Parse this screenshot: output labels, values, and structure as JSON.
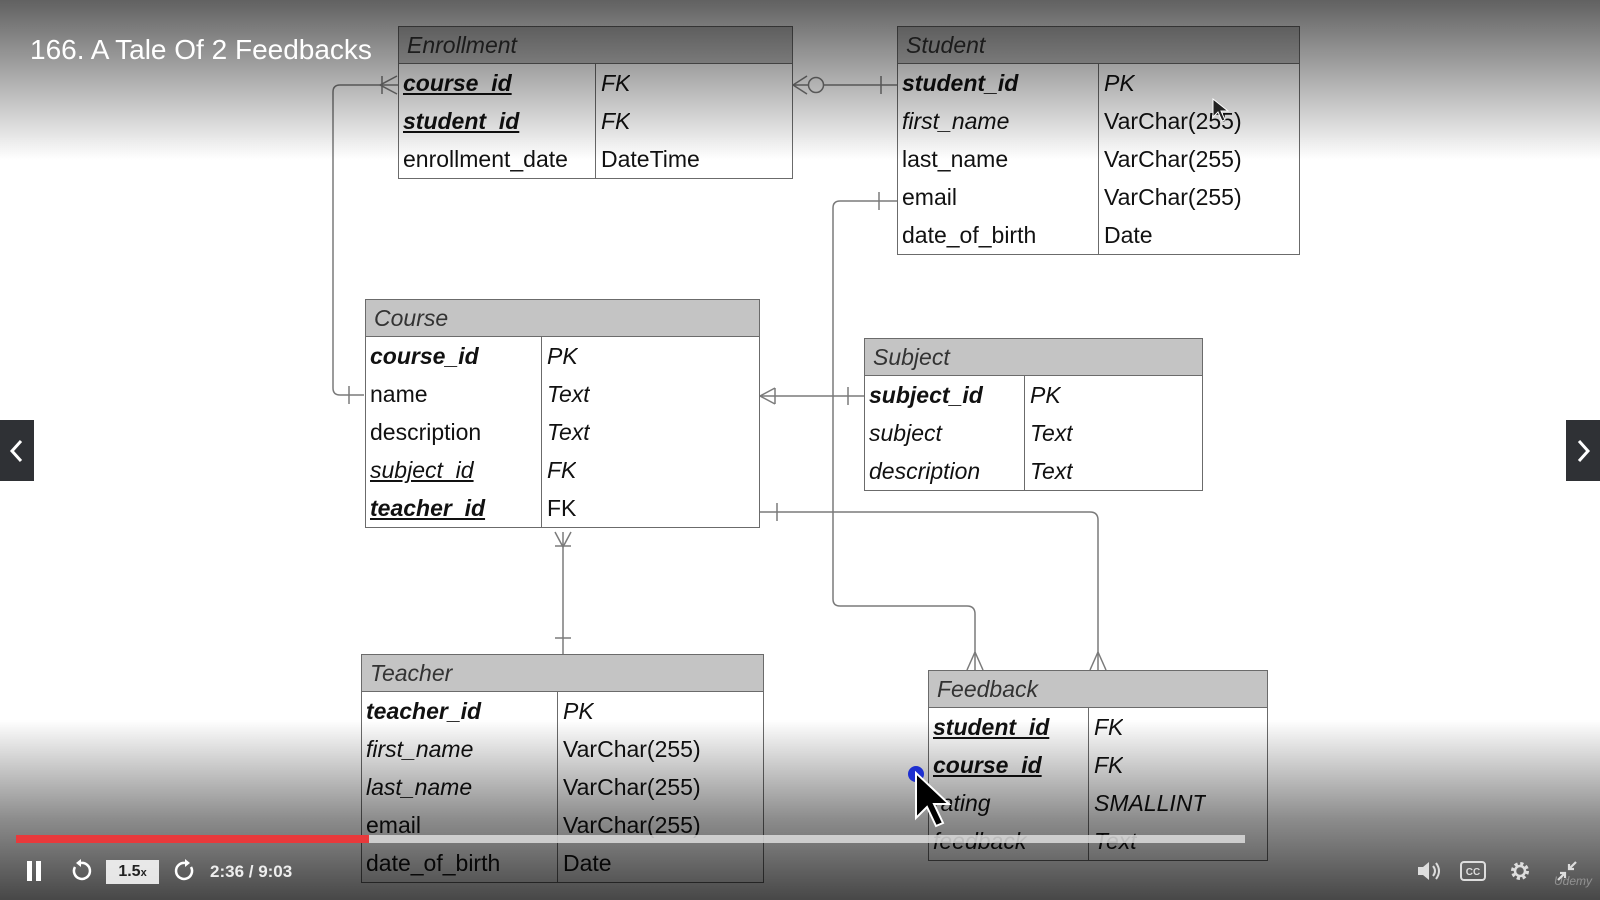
{
  "player": {
    "title": "166. A Tale Of 2 Feedbacks",
    "speed": "1.5",
    "speed_suffix": "x",
    "time_current": "2:36",
    "time_total": "9:03",
    "time_display": "2:36 / 9:03",
    "progress_fraction": 0.2875,
    "watermark": "Udemy",
    "accent_color": "#e8393b",
    "icons": {
      "prev": "chevron-left-icon",
      "next": "chevron-right-icon",
      "pause": "pause-icon",
      "rewind": "rewind-icon",
      "forward": "forward-icon",
      "volume": "volume-icon",
      "captions": "captions-icon",
      "settings": "gear-icon",
      "fullscreen": "exit-fullscreen-icon"
    }
  },
  "diagram": {
    "tables": {
      "enrollment": {
        "title": "Enrollment",
        "rows": [
          {
            "name": "course_id",
            "type": "FK"
          },
          {
            "name": "student_id",
            "type": "FK"
          },
          {
            "name": "enrollment_date",
            "type": "DateTime"
          }
        ]
      },
      "student": {
        "title": "Student",
        "rows": [
          {
            "name": "student_id",
            "type": "PK"
          },
          {
            "name": "first_name",
            "type": "VarChar(255)"
          },
          {
            "name": "last_name",
            "type": "VarChar(255)"
          },
          {
            "name": "email",
            "type": "VarChar(255)"
          },
          {
            "name": "date_of_birth",
            "type": "Date"
          }
        ]
      },
      "course": {
        "title": "Course",
        "rows": [
          {
            "name": "course_id",
            "type": "PK"
          },
          {
            "name": "name",
            "type": "Text"
          },
          {
            "name": "description",
            "type": "Text"
          },
          {
            "name": "subject_id",
            "type": "FK"
          },
          {
            "name": "teacher_id",
            "type": "FK"
          }
        ]
      },
      "subject": {
        "title": "Subject",
        "rows": [
          {
            "name": "subject_id",
            "type": "PK"
          },
          {
            "name": "subject",
            "type": "Text"
          },
          {
            "name": "description",
            "type": "Text"
          }
        ]
      },
      "teacher": {
        "title": "Teacher",
        "rows": [
          {
            "name": "teacher_id",
            "type": "PK"
          },
          {
            "name": "first_name",
            "type": "VarChar(255)"
          },
          {
            "name": "last_name",
            "type": "VarChar(255)"
          },
          {
            "name": "email",
            "type": "VarChar(255)"
          },
          {
            "name": "date_of_birth",
            "type": "Date"
          }
        ]
      },
      "feedback": {
        "title": "Feedback",
        "rows": [
          {
            "name": "student_id",
            "type": "FK"
          },
          {
            "name": "course_id",
            "type": "FK"
          },
          {
            "name": "rating",
            "type": "SMALLINT"
          },
          {
            "name": "feedback",
            "type": "Text"
          }
        ]
      }
    }
  }
}
